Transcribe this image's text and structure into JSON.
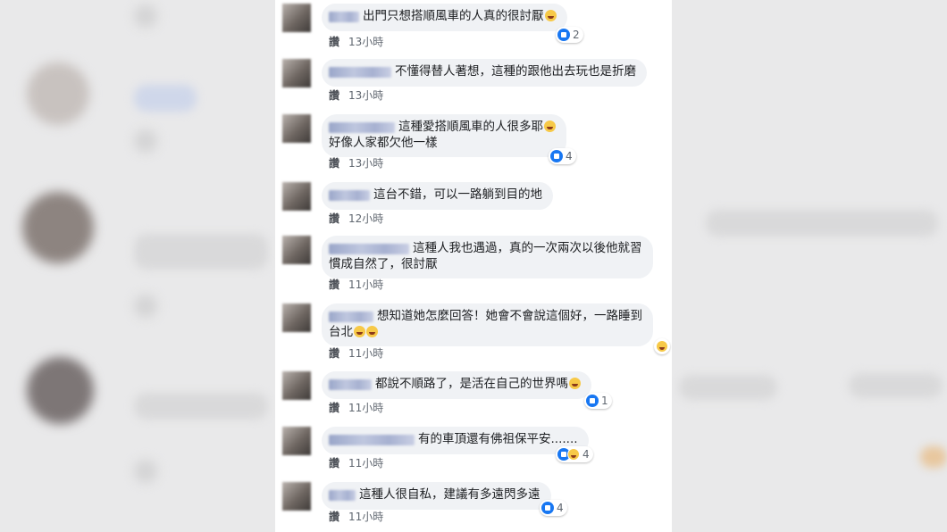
{
  "comments": [
    {
      "text": "出門只想搭順風車的人真的很討厭",
      "emoji": "grin-emoji",
      "like": "讚",
      "time": "13小時",
      "reactions": "2"
    },
    {
      "text": "不懂得替人著想，這種的跟他出去玩也是折磨",
      "like": "讚",
      "time": "13小時"
    },
    {
      "text": "這種愛搭順風車的人很多耶",
      "emoji": "laughing-emoji",
      "line2": "好像人家都欠他一樣",
      "like": "讚",
      "time": "13小時",
      "reactions": "4"
    },
    {
      "text": "這台不錯，可以一路躺到目的地",
      "like": "讚",
      "time": "12小時"
    },
    {
      "text": "這種人我也遇過，真的一次兩次以後他就習",
      "line2": "慣成自然了，很討厭",
      "like": "讚",
      "time": "11小時"
    },
    {
      "text": "想知道她怎麼回答！她會不會說這個好，一路睡到",
      "line2": "台北",
      "emoji": "laughing-emoji",
      "like": "讚",
      "time": "11小時",
      "reaction_icon": "haha-icon"
    },
    {
      "text": "都說不順路了，是活在自己的世界嗎",
      "emoji": "thinking-emoji",
      "like": "讚",
      "time": "11小時",
      "reactions": "1"
    },
    {
      "text": "有的車頂還有佛祖保平安.......",
      "like": "讚",
      "time": "11小時",
      "reactions": "4"
    },
    {
      "text": "這種人很自私，建議有多遠閃多遠",
      "like": "讚",
      "time": "11小時",
      "reactions": "4"
    }
  ],
  "colors": {
    "bubble": "#f0f2f5",
    "like_blue": "#1877f2",
    "panel": "#ffffff"
  }
}
